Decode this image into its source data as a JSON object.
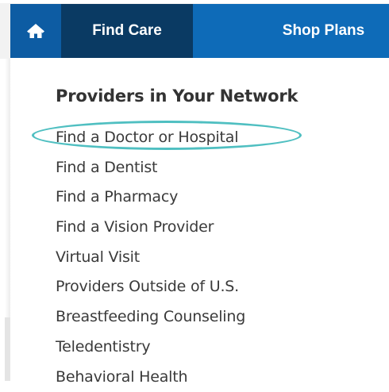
{
  "nav": {
    "home_icon": "home-icon",
    "find_care_label": "Find Care",
    "shop_plans_label": "Shop Plans",
    "colors": {
      "bar": "#0e6bb8",
      "home": "#0d5ca3",
      "active": "#0a3a63"
    }
  },
  "dropdown": {
    "heading": "Providers in Your Network",
    "items": [
      {
        "label": "Find a Doctor or Hospital"
      },
      {
        "label": "Find a Dentist"
      },
      {
        "label": "Find a Pharmacy"
      },
      {
        "label": "Find a Vision Provider"
      },
      {
        "label": "Virtual Visit"
      },
      {
        "label": "Providers Outside of U.S."
      },
      {
        "label": "Breastfeeding Counseling"
      },
      {
        "label": "Teledentistry"
      },
      {
        "label": "Behavioral Health"
      }
    ],
    "highlight_color": "#4fbfc1"
  }
}
